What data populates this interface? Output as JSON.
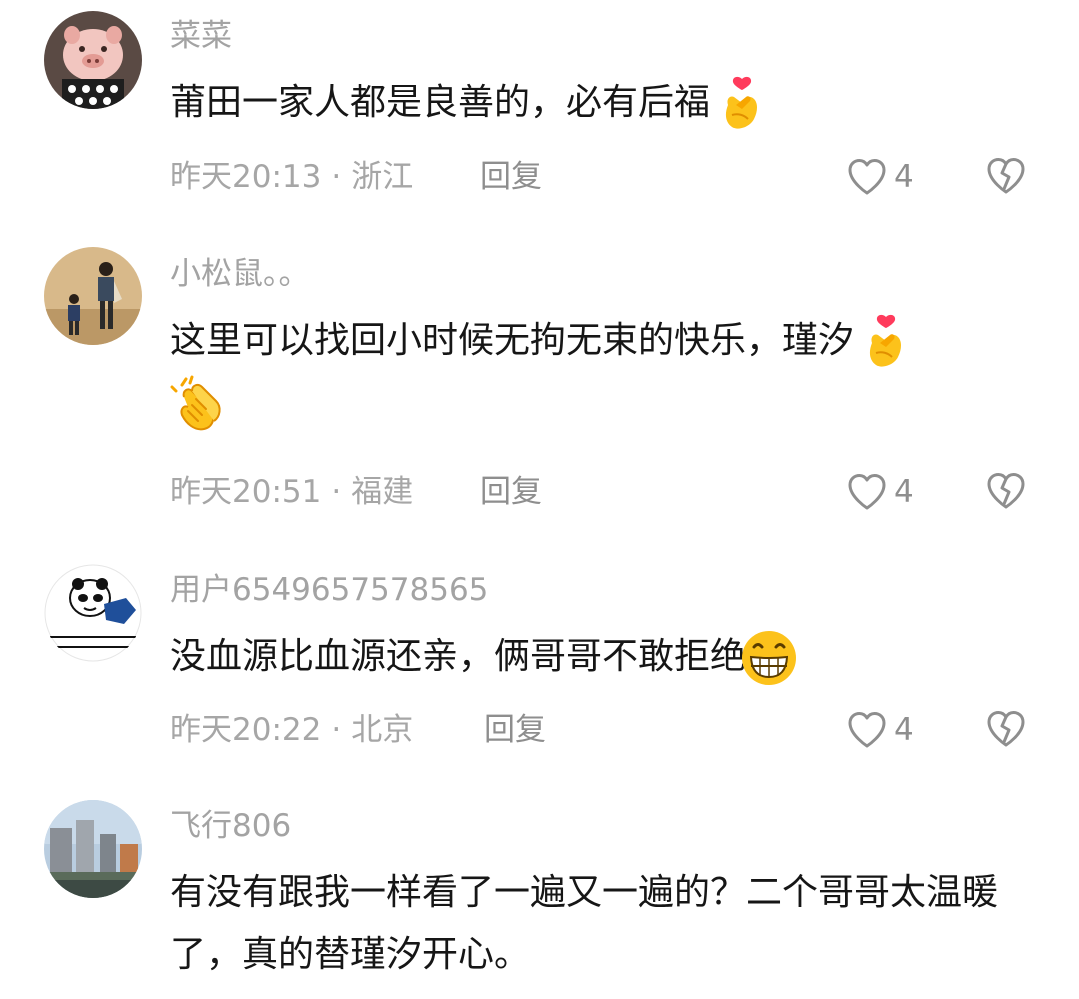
{
  "comments": [
    {
      "username": "菜菜",
      "text": "莆田一家人都是良善的，必有后福",
      "emojis": [
        "finger-heart-emoji"
      ],
      "time": "昨天20:13",
      "separator": "·",
      "location": "浙江",
      "reply_label": "回复",
      "likes": "4"
    },
    {
      "username": "小松鼠。。",
      "text": "这里可以找回小时候无拘无束的快乐，瑾汐",
      "emojis": [
        "finger-heart-emoji",
        "clapping-hands-emoji"
      ],
      "time": "昨天20:51",
      "separator": "·",
      "location": "福建",
      "reply_label": "回复",
      "likes": "4"
    },
    {
      "username": "用户6549657578565",
      "text": "没血源比血源还亲，俩哥哥不敢拒绝",
      "emojis": [
        "grinning-face-emoji"
      ],
      "time": "昨天20:22",
      "separator": "·",
      "location": "北京",
      "reply_label": "回复",
      "likes": "4"
    },
    {
      "username": "飞行806",
      "text": "有没有跟我一样看了一遍又一遍的？二个哥哥太温暖了，真的替瑾汐开心。"
    }
  ],
  "icons": {
    "like": "heart-outline-icon",
    "dislike": "broken-heart-icon"
  },
  "colors": {
    "text": "#161616",
    "secondary": "#a6a6a6",
    "icon": "#8e8e8e"
  }
}
